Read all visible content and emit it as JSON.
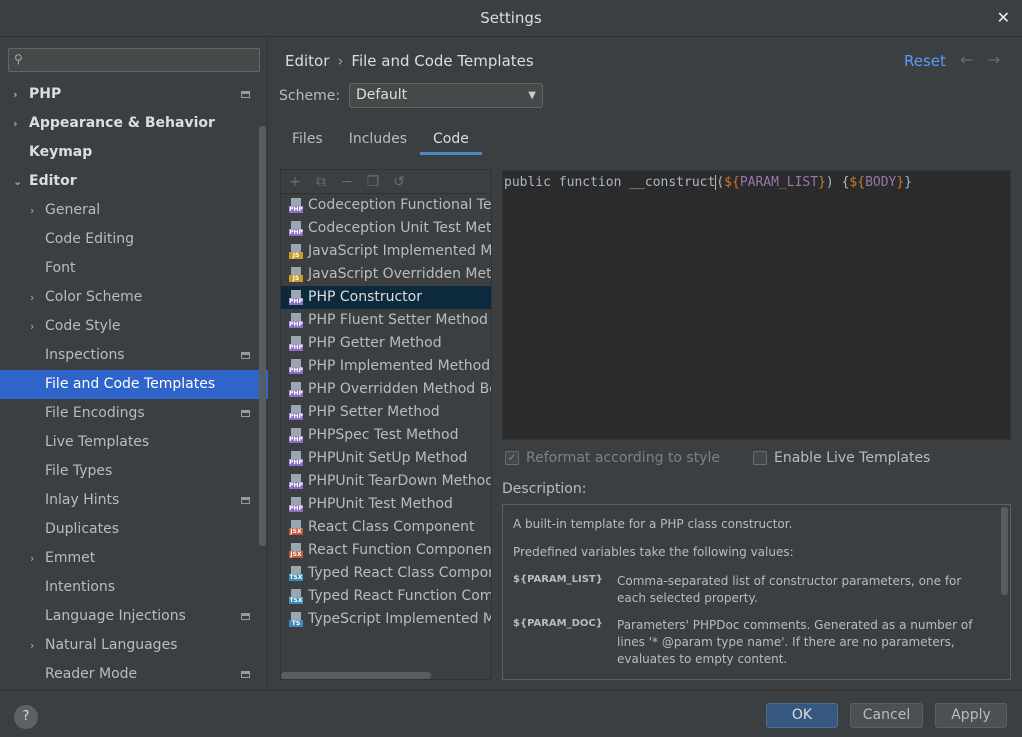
{
  "window": {
    "title": "Settings",
    "close_glyph": "✕"
  },
  "search": {
    "placeholder": "",
    "icon": "search-icon"
  },
  "sidebar": {
    "items": [
      {
        "label": "PHP",
        "level": 0,
        "arrow": "›",
        "proj": true
      },
      {
        "label": "Appearance & Behavior",
        "level": 0,
        "arrow": "›",
        "proj": false
      },
      {
        "label": "Keymap",
        "level": 0,
        "arrow": "",
        "proj": false
      },
      {
        "label": "Editor",
        "level": 0,
        "arrow": "⌄",
        "proj": false
      },
      {
        "label": "General",
        "level": 1,
        "arrow": "›",
        "proj": false
      },
      {
        "label": "Code Editing",
        "level": 1,
        "arrow": "",
        "proj": false
      },
      {
        "label": "Font",
        "level": 1,
        "arrow": "",
        "proj": false
      },
      {
        "label": "Color Scheme",
        "level": 1,
        "arrow": "›",
        "proj": false
      },
      {
        "label": "Code Style",
        "level": 1,
        "arrow": "›",
        "proj": false
      },
      {
        "label": "Inspections",
        "level": 1,
        "arrow": "",
        "proj": true
      },
      {
        "label": "File and Code Templates",
        "level": 1,
        "arrow": "",
        "proj": false,
        "selected": true
      },
      {
        "label": "File Encodings",
        "level": 1,
        "arrow": "",
        "proj": true
      },
      {
        "label": "Live Templates",
        "level": 1,
        "arrow": "",
        "proj": false
      },
      {
        "label": "File Types",
        "level": 1,
        "arrow": "",
        "proj": false
      },
      {
        "label": "Inlay Hints",
        "level": 1,
        "arrow": "",
        "proj": true
      },
      {
        "label": "Duplicates",
        "level": 1,
        "arrow": "",
        "proj": false
      },
      {
        "label": "Emmet",
        "level": 1,
        "arrow": "›",
        "proj": false
      },
      {
        "label": "Intentions",
        "level": 1,
        "arrow": "",
        "proj": false
      },
      {
        "label": "Language Injections",
        "level": 1,
        "arrow": "",
        "proj": true
      },
      {
        "label": "Natural Languages",
        "level": 1,
        "arrow": "›",
        "proj": false
      },
      {
        "label": "Reader Mode",
        "level": 1,
        "arrow": "",
        "proj": true
      }
    ]
  },
  "header": {
    "breadcrumb_parent": "Editor",
    "breadcrumb_sep": "›",
    "breadcrumb_current": "File and Code Templates",
    "reset_label": "Reset",
    "back_glyph": "←",
    "forward_glyph": "→"
  },
  "scheme": {
    "label": "Scheme:",
    "value": "Default",
    "caret": "▼"
  },
  "tabs": [
    {
      "label": "Files",
      "active": false
    },
    {
      "label": "Includes",
      "active": false
    },
    {
      "label": "Code",
      "active": true
    }
  ],
  "list_toolbar": [
    "+",
    "⧉",
    "−",
    "❐",
    "↺"
  ],
  "templates": [
    {
      "label": "Codeception Functional Test Method",
      "badge": "PHP",
      "color": "#8b6fc2"
    },
    {
      "label": "Codeception Unit Test Method",
      "badge": "PHP",
      "color": "#8b6fc2"
    },
    {
      "label": "JavaScript Implemented Method",
      "badge": "JS",
      "color": "#c49b2c"
    },
    {
      "label": "JavaScript Overridden Method",
      "badge": "JS",
      "color": "#c49b2c"
    },
    {
      "label": "PHP Constructor",
      "badge": "PHP",
      "color": "#8b6fc2",
      "selected": true
    },
    {
      "label": "PHP Fluent Setter Method",
      "badge": "PHP",
      "color": "#8b6fc2"
    },
    {
      "label": "PHP Getter Method",
      "badge": "PHP",
      "color": "#8b6fc2"
    },
    {
      "label": "PHP Implemented Method Body",
      "badge": "PHP",
      "color": "#8b6fc2"
    },
    {
      "label": "PHP Overridden Method Body",
      "badge": "PHP",
      "color": "#8b6fc2"
    },
    {
      "label": "PHP Setter Method",
      "badge": "PHP",
      "color": "#8b6fc2"
    },
    {
      "label": "PHPSpec Test Method",
      "badge": "PHP",
      "color": "#8b6fc2"
    },
    {
      "label": "PHPUnit SetUp Method",
      "badge": "PHP",
      "color": "#8b6fc2"
    },
    {
      "label": "PHPUnit TearDown Method",
      "badge": "PHP",
      "color": "#8b6fc2"
    },
    {
      "label": "PHPUnit Test Method",
      "badge": "PHP",
      "color": "#8b6fc2"
    },
    {
      "label": "React Class Component",
      "badge": "JSX",
      "color": "#c2583b"
    },
    {
      "label": "React Function Component",
      "badge": "JSX",
      "color": "#c2583b"
    },
    {
      "label": "Typed React Class Component",
      "badge": "TSX",
      "color": "#3d8bb8"
    },
    {
      "label": "Typed React Function Component",
      "badge": "TSX",
      "color": "#3d8bb8"
    },
    {
      "label": "TypeScript Implemented Method",
      "badge": "TS",
      "color": "#3d8bb8"
    }
  ],
  "editor": {
    "keyword": "public function __construct",
    "open_paren": "(",
    "param_open": "${",
    "param_name": "PARAM_LIST",
    "param_close": "}",
    "close_paren": ") ",
    "brace_open": "{",
    "body_open": "${",
    "body_name": "BODY",
    "body_close": "}",
    "brace_close": "}"
  },
  "options": {
    "reformat_label": "Reformat according to style",
    "reformat_checked": true,
    "live_label": "Enable Live Templates",
    "live_checked": false,
    "check_glyph": "✓"
  },
  "description": {
    "label": "Description:",
    "intro": "A built-in template for a PHP class constructor.",
    "predef": "Predefined variables take the following values:",
    "vars": [
      {
        "key": "${PARAM_LIST}",
        "val": "Comma-separated list of constructor parameters, one for each selected property."
      },
      {
        "key": "${PARAM_DOC}",
        "val": "Parameters' PHPDoc comments. Generated as a number of lines '* @param type name'. If there are no parameters, evaluates to empty content."
      }
    ]
  },
  "footer": {
    "help": "?",
    "ok": "OK",
    "cancel": "Cancel",
    "apply": "Apply"
  }
}
